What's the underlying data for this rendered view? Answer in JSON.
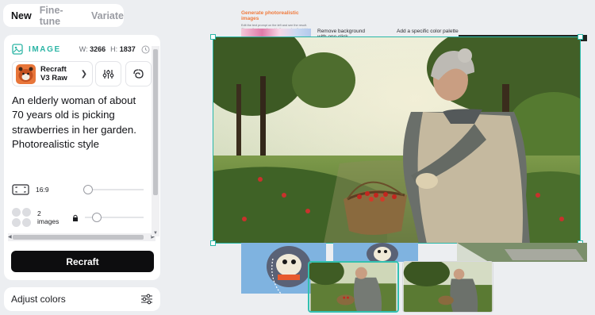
{
  "tabs": [
    {
      "label": "New",
      "active": true
    },
    {
      "label": "Fine-tune",
      "active": false
    },
    {
      "label": "Variate",
      "active": false
    }
  ],
  "panel": {
    "section_label": "IMAGE",
    "width_label": "W:",
    "width_value": "3266",
    "height_label": "H:",
    "height_value": "1837",
    "model_name_line1": "Recraft",
    "model_name_line2": "V3 Raw",
    "prompt": "An elderly woman of about 70 years old is picking strawberries in her garden. Photorealistic style",
    "aspect_ratio": "16:9",
    "aspect_slider_position": 0.05,
    "images_count_line1": "2",
    "images_count_line2": "images",
    "images_slider_position": 0.2,
    "generate_label": "Recraft"
  },
  "adjust": {
    "label": "Adjust colors"
  },
  "canvas": {
    "card_title": "Generate photorealistic images",
    "card_text": "Edit the text prompt on the left and see the result. Change the image format in the panel on the right. Click \"Recraft\".",
    "note_remove_bg": "Remove background",
    "note_remove_bg_2": "with one click",
    "note_color_palette": "Add a specific color palette"
  },
  "colors": {
    "accent": "#29b8a8",
    "button_dark": "#0d0d0f",
    "title_orange": "#f07a3c"
  },
  "icons": {
    "image_section": "image-icon",
    "clock": "clock-icon",
    "model_avatar": "red-panda-avatar",
    "settings_sliders": "sliders-icon",
    "style_palette": "swirl-icon",
    "aspect": "aspect-ratio-icon",
    "images": "images-icon",
    "lock": "lock-icon",
    "adjust": "adjust-sliders-icon",
    "chevron": "chevron-right-icon"
  }
}
